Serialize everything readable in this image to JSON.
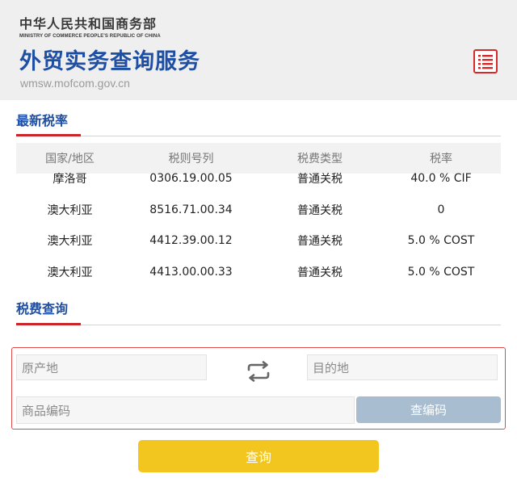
{
  "header": {
    "ministry_cn": "中华人民共和国商务部",
    "ministry_en": "MINISTRY OF COMMERCE PEOPLE'S REPUBLIC OF CHINA",
    "site_title": "外贸实务查询服务",
    "site_url": "wmsw.mofcom.gov.cn",
    "menu_icon": "list-menu-icon"
  },
  "latest_rates": {
    "title": "最新税率",
    "columns": [
      "国家/地区",
      "税则号列",
      "税费类型",
      "税率"
    ],
    "rows": [
      [
        "摩洛哥",
        "0306.19.00.05",
        "普通关税",
        "40.0 % CIF"
      ],
      [
        "澳大利亚",
        "8516.71.00.34",
        "普通关税",
        "0"
      ],
      [
        "澳大利亚",
        "4412.39.00.12",
        "普通关税",
        "5.0 % COST"
      ],
      [
        "澳大利亚",
        "4413.00.00.33",
        "普通关税",
        "5.0 % COST"
      ]
    ]
  },
  "tax_query": {
    "title": "税费查询",
    "origin_placeholder": "原产地",
    "destination_placeholder": "目的地",
    "swap_icon": "swap-arrows-icon",
    "product_code_placeholder": "商品编码",
    "lookup_code_label": "查编码",
    "query_label": "查询"
  },
  "colors": {
    "brand_blue": "#1e4fa3",
    "accent_red": "#c9252b",
    "query_yellow": "#f2c61f",
    "code_button_blue": "#a9bdd0"
  }
}
